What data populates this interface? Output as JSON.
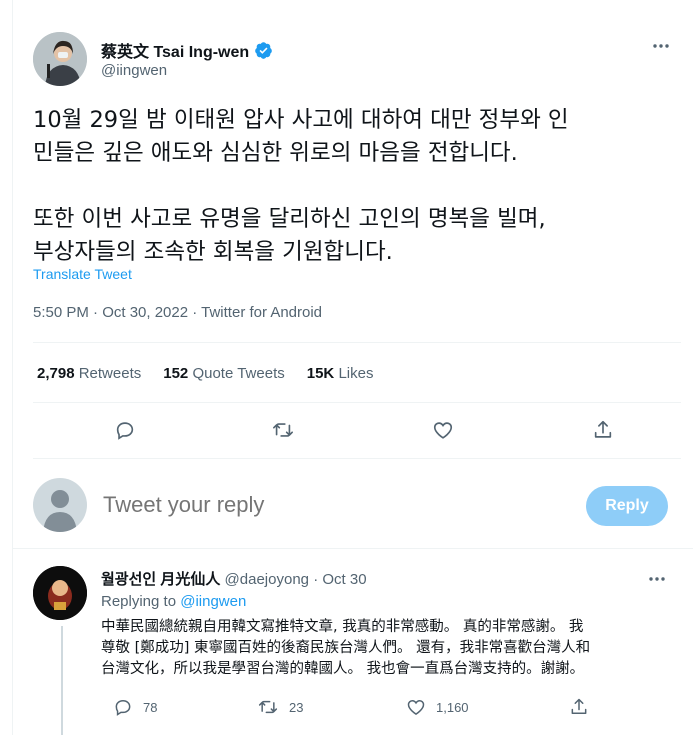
{
  "main_tweet": {
    "author_name": "蔡英文 Tsai Ing-wen",
    "author_handle": "@iingwen",
    "text_lines": [
      "10월 29일 밤 이태원 압사 사고에 대하여 대만 정부와 인",
      "민들은 깊은 애도와 심심한 위로의 마음을 전합니다.",
      "또한 이번 사고로 유명을 달리하신 고인의 명복을 빌며,",
      "부상자들의 조속한 회복을 기원합니다."
    ],
    "translate_label": "Translate Tweet",
    "timestamp": "5:50 PM · Oct 30, 2022 · Twitter for Android",
    "stats": {
      "retweets_count": "2,798",
      "retweets_label": "Retweets",
      "quotes_count": "152",
      "quotes_label": "Quote Tweets",
      "likes_count": "15K",
      "likes_label": "Likes"
    },
    "icons": [
      "reply-icon",
      "retweet-icon",
      "like-icon",
      "share-icon"
    ]
  },
  "composer": {
    "placeholder": "Tweet your reply",
    "button_label": "Reply"
  },
  "reply_tweet": {
    "author_name": "월광선인 月光仙人",
    "author_handle": "@daejoyong",
    "separator": "·",
    "date": "Oct 30",
    "replying_prefix": "Replying to",
    "replying_mention": "@iingwen",
    "text_lines": [
      "中華民國總統親自用韓文寫推特文章, 我真的非常感動。 真的非常感謝。 我",
      "尊敬 [鄭成功] 東寧國百姓的後裔民族台灣人們。 還有，我非常喜歡台灣人和",
      "台灣文化，所以我是學習台灣的韓國人。 我也會一直爲台灣支持的。謝謝。"
    ],
    "reply_count": "78",
    "retweet_count": "23",
    "like_count": "1,160"
  },
  "colors": {
    "accent": "#1d9bf0",
    "secondary_text": "#536471",
    "divider": "#eff3f4",
    "reply_button_disabled": "#8ecdf8"
  }
}
